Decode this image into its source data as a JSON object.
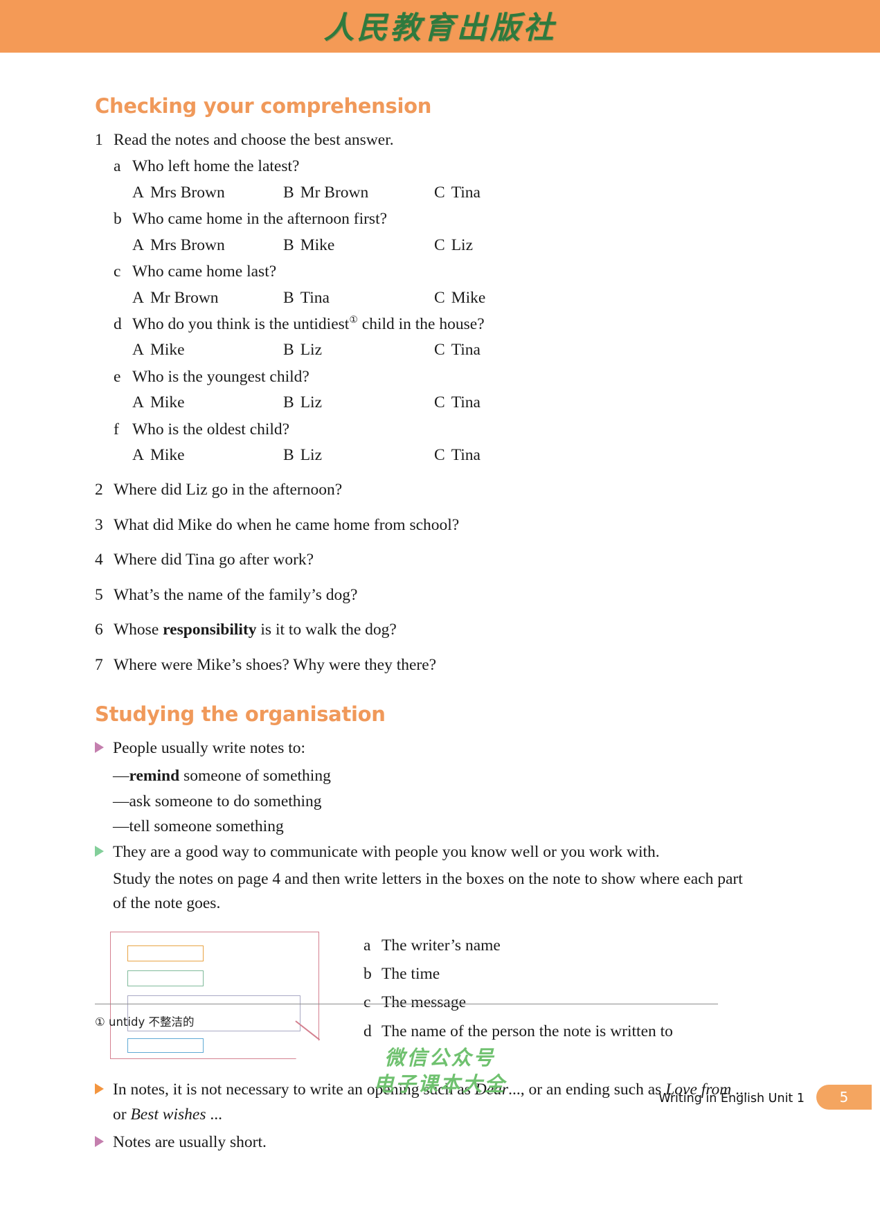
{
  "header": {
    "publisher_logo": "人民教育出版社",
    "band_color": "#f49a56",
    "logo_color": "#2f7a3e"
  },
  "sections": {
    "comprehension": {
      "title": "Checking your comprehension",
      "title_color": "#f0995a",
      "item1": {
        "num": "1",
        "text": "Read the notes and choose the best answer.",
        "questions": [
          {
            "letter": "a",
            "text": "Who left home the latest?",
            "options": [
              {
                "tag": "A",
                "label": "Mrs Brown"
              },
              {
                "tag": "B",
                "label": "Mr Brown"
              },
              {
                "tag": "C",
                "label": "Tina"
              }
            ]
          },
          {
            "letter": "b",
            "text": "Who came home in the afternoon first?",
            "options": [
              {
                "tag": "A",
                "label": "Mrs Brown"
              },
              {
                "tag": "B",
                "label": "Mike"
              },
              {
                "tag": "C",
                "label": "Liz"
              }
            ]
          },
          {
            "letter": "c",
            "text": "Who came home last?",
            "options": [
              {
                "tag": "A",
                "label": "Mr Brown"
              },
              {
                "tag": "B",
                "label": "Tina"
              },
              {
                "tag": "C",
                "label": "Mike"
              }
            ]
          },
          {
            "letter": "d",
            "text_before": "Who do you think is the untidiest",
            "footnote_marker": "①",
            "text_after": " child in the house?",
            "options": [
              {
                "tag": "A",
                "label": "Mike"
              },
              {
                "tag": "B",
                "label": "Liz"
              },
              {
                "tag": "C",
                "label": "Tina"
              }
            ]
          },
          {
            "letter": "e",
            "text": "Who is the youngest child?",
            "options": [
              {
                "tag": "A",
                "label": "Mike"
              },
              {
                "tag": "B",
                "label": "Liz"
              },
              {
                "tag": "C",
                "label": "Tina"
              }
            ]
          },
          {
            "letter": "f",
            "text": "Who is the oldest child?",
            "options": [
              {
                "tag": "A",
                "label": "Mike"
              },
              {
                "tag": "B",
                "label": "Liz"
              },
              {
                "tag": "C",
                "label": "Tina"
              }
            ]
          }
        ]
      },
      "items": [
        {
          "num": "2",
          "text": "Where did Liz go in the afternoon?"
        },
        {
          "num": "3",
          "text": "What did Mike do when he came home from school?"
        },
        {
          "num": "4",
          "text": "Where did Tina go after work?"
        },
        {
          "num": "5",
          "text": "What’s the name of the family’s dog?"
        },
        {
          "num": "6",
          "text_before": "Whose ",
          "bold": "responsibility",
          "text_after": " is it to walk the dog?"
        },
        {
          "num": "7",
          "text": "Where were Mike’s shoes? Why were they there?"
        }
      ]
    },
    "organisation": {
      "title": "Studying the organisation",
      "title_color": "#f0995a",
      "bullet1": {
        "text": "People usually write notes to:",
        "marker_color": "#c47fae"
      },
      "dashes": [
        {
          "dash": "—",
          "bold": "remind",
          "rest": " someone of something"
        },
        {
          "dash": "—",
          "bold": "",
          "rest": "ask someone to do something"
        },
        {
          "dash": "—",
          "bold": "",
          "rest": "tell someone something"
        }
      ],
      "bullet2": {
        "text": "They are a good way to communicate with people you know well or you work with.",
        "marker_color": "#83cf9a"
      },
      "instruction": "Study the notes on page 4 and then write letters in the boxes on the note to show where each part of the note goes.",
      "note_diagram": {
        "frame_color": "#d4808f",
        "boxes": [
          {
            "name": "box-a",
            "color": "#e8a344"
          },
          {
            "name": "box-b",
            "color": "#7fba9a"
          },
          {
            "name": "box-c",
            "color": "#a9a9c4"
          },
          {
            "name": "box-d",
            "color": "#5fa9d4"
          }
        ]
      },
      "answer_key": [
        {
          "letter": "a",
          "label": "The writer’s name"
        },
        {
          "letter": "b",
          "label": "The time"
        },
        {
          "letter": "c",
          "label": "The message"
        },
        {
          "letter": "d",
          "label": "The name of the person the note is written to"
        }
      ],
      "bullet3": {
        "marker_color": "#f3953f",
        "part1": "In notes, it is not necessary to write an opening such as ",
        "italic1": "Dear",
        "part2": "..., or an ending such as ",
        "italic2": "Love from",
        "part3": " ... or ",
        "italic3": "Best wishes",
        "part4": " ..."
      },
      "bullet4": {
        "marker_color": "#c47fae",
        "text": "Notes are usually short."
      }
    }
  },
  "footnote": {
    "marker": "①",
    "word": "untidy",
    "gloss": "不整洁的",
    "full": "① untidy 不整洁的"
  },
  "watermark": {
    "line1": "微信公众号",
    "line2": "电子课本大全",
    "color": "#6fc16f"
  },
  "footer": {
    "label": "Writing in English Unit 1",
    "page_number": "5",
    "tab_color": "#f4a560"
  }
}
